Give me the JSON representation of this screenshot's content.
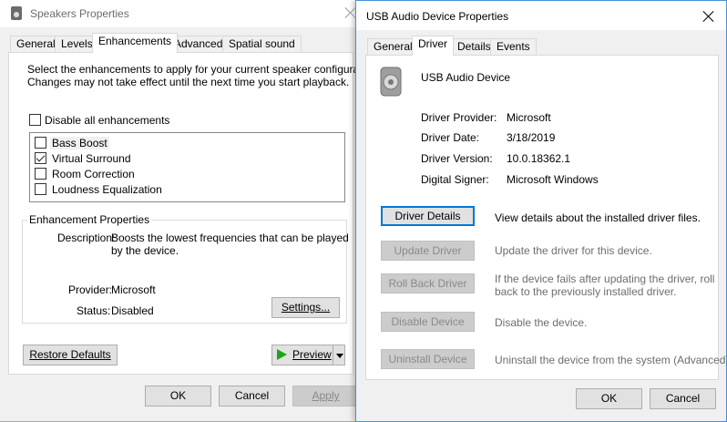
{
  "speakers": {
    "title": "Speakers Properties",
    "tabs": [
      "General",
      "Levels",
      "Enhancements",
      "Advanced",
      "Spatial sound"
    ],
    "active_tab": "Enhancements",
    "instructions_line1": "Select the enhancements to apply for your current speaker configuration.",
    "instructions_line2": "Changes may not take effect until the next time you start playback.",
    "disable_all_label": "Disable all enhancements",
    "enhancements": [
      {
        "label": "Bass Boost",
        "checked": false
      },
      {
        "label": "Virtual Surround",
        "checked": true
      },
      {
        "label": "Room Correction",
        "checked": false
      },
      {
        "label": "Loudness Equalization",
        "checked": false
      }
    ],
    "properties_group_label": "Enhancement Properties",
    "description_label": "Description:",
    "description_line1": "Boosts the lowest frequencies that can be played",
    "description_line2": "by the device.",
    "provider_label": "Provider:",
    "provider_value": "Microsoft",
    "status_label": "Status:",
    "status_value": "Disabled",
    "settings_button": "Settings...",
    "restore_defaults_button": "Restore Defaults",
    "preview_button": "Preview",
    "ok_button": "OK",
    "cancel_button": "Cancel",
    "apply_button": "Apply"
  },
  "usb": {
    "title": "USB Audio Device Properties",
    "tabs": [
      "General",
      "Driver",
      "Details",
      "Events"
    ],
    "active_tab": "Driver",
    "device_name": "USB Audio Device",
    "info": [
      {
        "label": "Driver Provider:",
        "value": "Microsoft"
      },
      {
        "label": "Driver Date:",
        "value": "3/18/2019"
      },
      {
        "label": "Driver Version:",
        "value": "10.0.18362.1"
      },
      {
        "label": "Digital Signer:",
        "value": "Microsoft Windows"
      }
    ],
    "actions": [
      {
        "button": "Driver Details",
        "desc1": "View details about the installed driver files.",
        "desc2": "",
        "enabled": true
      },
      {
        "button": "Update Driver",
        "desc1": "Update the driver for this device.",
        "desc2": "",
        "enabled": false
      },
      {
        "button": "Roll Back Driver",
        "desc1": "If the device fails after updating the driver, roll",
        "desc2": "back to the previously installed driver.",
        "enabled": false
      },
      {
        "button": "Disable Device",
        "desc1": "Disable the device.",
        "desc2": "",
        "enabled": false
      },
      {
        "button": "Uninstall Device",
        "desc1": "Uninstall the device from the system (Advanced).",
        "desc2": "",
        "enabled": false
      }
    ],
    "ok_button": "OK",
    "cancel_button": "Cancel"
  },
  "colors": {
    "accent": "#0078d7",
    "preview_arrow": "#1aa61a"
  }
}
